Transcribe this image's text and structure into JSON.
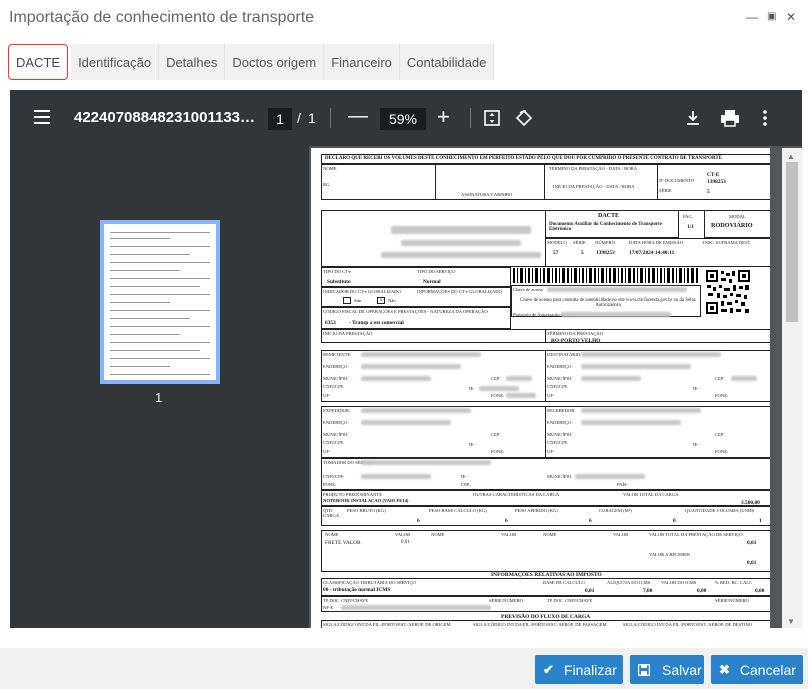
{
  "window": {
    "title": "Importação de conhecimento de transporte"
  },
  "tabs": [
    "DACTE",
    "Identificação",
    "Detalhes",
    "Doctos origem",
    "Financeiro",
    "Contabilidade"
  ],
  "viewer": {
    "filename": "42240708848231001133…",
    "page_current": "1",
    "page_sep": "/",
    "page_total": "1",
    "zoom": "59%",
    "thumb_label": "1"
  },
  "document": {
    "receipt_decl": "DECLARO QUE RECEBI OS VOLUMES DESTE CONHECIMENTO EM PERFEITO ESTADO PELO QUE DOU POR CUMPRIDO O PRESENTE CONTRATO DE TRANSPORTE",
    "nome": "NOME",
    "rg": "RG",
    "assinatura": "ASSINATURA/CARIMBO",
    "termino_prest": "TÉRMINO DA PRESTAÇÃO - DATA / HORA",
    "inicio_prest": "INÍCIO DA PRESTAÇÃO - DATA / HORA",
    "nr_doc_lbl": "Nº DOCUMENTO",
    "serie_lbl": "SÉRIE",
    "cte_lbl": "CT-E",
    "cte_num": "1398253",
    "cte_serie": "5",
    "dacte": "DACTE",
    "dacte_sub": "Documento Auxiliar do Conhecimento de Transporte Eletrônico",
    "pag_lbl": "PAG.",
    "pag_val": "1/1",
    "modal_lbl": "MODAL",
    "modal_val": "RODOVIÁRIO",
    "modelo_lbl": "MODELO",
    "modelo_val": "57",
    "serie_col": "SÉRIE",
    "serie_val": "5",
    "numero_lbl": "NÚMERO",
    "numero_val": "1398253",
    "data_emissao_lbl": "DATA HORA DE EMISSÃO",
    "data_emissao_val": "17/07/2024 14:40:11",
    "insc_suframa": "INSC. SUFRAMA DEST.",
    "tipo_cte_lbl": "TIPO DO CT-e",
    "tipo_cte_val": "Substituto",
    "tipo_serv_lbl": "TIPO DO SERVIÇO",
    "tipo_serv_val": "Normal",
    "chave_acesso": "Chave de acesso",
    "ind_glob": "INDICADOR DO CT-e GLOBALIZADO",
    "sim": "Sim",
    "nao": "Não",
    "info_glob": "INFORMAÇÕES DO CT-e GLOBALIZADO",
    "consulta": "Chave de acesso para consulta de autenticidade no site www.cte.fazenda.gov.br ou da Sefaz Autorizadora",
    "cfop_lbl": "CÓDIGO FISCAL DE OPERAÇÕES E PRESTAÇÕES - NATUREZA DA OPERAÇÃO",
    "cfop_val": "6353",
    "cfop_desc": "- Transp a est comercial",
    "protocolo": "Protocolo de Autorização de Uso",
    "inicio_lbl": "INÍCIO DA PRESTAÇÃO",
    "termino_lbl": "TÉRMINO DA PRESTAÇÃO",
    "termino_val": "RO-PORTO VELHO",
    "remetente": "REMETENTE:",
    "destinatario": "DESTINATÁRIO:",
    "expedidor": "EXPEDIDOR:",
    "recebedor": "RECEBEDOR:",
    "tomador": "TOMADOR DO SERVIÇO",
    "endereco": "ENDEREÇO:",
    "municipio": "MUNICÍPIO:",
    "cnpj": "CNPJ/CPF:",
    "uf": "UF:",
    "cep": "CEP:",
    "ie": "IE:",
    "fone": "FONE:",
    "pais": "PAÍS:",
    "produto_lbl": "PRODUTO PREDOMINANTE",
    "produto_val": "NOTEBOOK INSTALACAO (VAIO FE14)",
    "outras_carac": "OUTRAS CARACTERÍSTICAS DA CARGA",
    "valor_total_carga_lbl": "VALOR TOTAL DA CARGA",
    "valor_total_carga_val": "3.500,00",
    "qtd_carga": "QTD CARGA",
    "peso_bruto": "PESO BRUTO (KG)",
    "peso_bruto_val": "6",
    "peso_base": "PESO BASE CÁLCULO (KG)",
    "peso_base_val": "6",
    "peso_aferido": "PESO AFERIDO (KG)",
    "peso_aferido_val": "6",
    "cubagem": "CUBAGEM (M³)",
    "cubagem_val": "0",
    "qtd_vol": "QUANTIDADE VOLUMES (UNID)",
    "qtd_vol_val": "1",
    "nome_col": "NOME",
    "valor_col": "VALOR",
    "frete_valor": "FRETE VALOR",
    "frete_val": "0,01",
    "valor_total_prest_lbl": "VALOR TOTAL DA PRESTAÇÃO DE SERVIÇO",
    "valor_total_prest_val": "0,01",
    "valor_receber_lbl": "VALOR A RECEBER",
    "valor_receber_val": "0,01",
    "info_imposto": "INFORMAÇÕES RELATIVAS AO IMPOSTO",
    "class_trib_lbl": "CLASSIFICAÇÃO TRIBUTÁRIA DO SERVIÇO",
    "class_trib_val": "00 - tributação normal ICMS",
    "base_calc": "BASE DE CALCULO",
    "base_calc_val": "0,01",
    "aliq": "ALÍQUOTA DO ICMS",
    "aliq_val": "7,00",
    "valor_icms": "VALOR DO ICMS",
    "valor_icms_val": "0,00",
    "red_bc": "% RED. BC. CALC",
    "red_bc_val": "0,00",
    "tp_doc": "TP DOC",
    "cnpj_chave": "CNPJ/CHAVE",
    "serie_numero": "SÉRIE/NÚMERO",
    "nfe": "NF-E",
    "previsao": "PREVISÃO DO FLUXO DE CARGA",
    "sigla_origem": "SIGLA/CÓDIGO INT.DA FIL./PORTO/EST./AEROP. DE ORIGEM",
    "sigla_passagem": "SIGLA/CÓDIGO INT.DA FIL./PORTO/EST./AEROP. DE PASSAGEM",
    "sigla_destino": "SIGLA/CÓDIGO INT.DA FIL./PORTO/EST./AEROP. DE DESTINO"
  },
  "buttons": {
    "finalizar": "Finalizar",
    "salvar": "Salvar",
    "cancelar": "Cancelar"
  },
  "colors": {
    "accent": "#2a82cb",
    "tab_active_border": "#e33333",
    "viewer_bg": "#525659",
    "toolbar_bg": "#323639"
  }
}
